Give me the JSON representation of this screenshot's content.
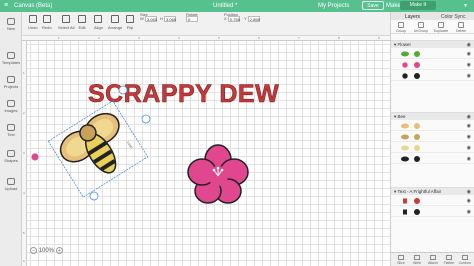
{
  "header": {
    "app_title": "Canvas (Beta)",
    "doc_title": "Untitled *",
    "my_projects": "My Projects",
    "save_label": "Save",
    "machine": "Maker",
    "make_it": "Make It"
  },
  "toolbar": {
    "undo": "Undo",
    "redo": "Redo",
    "linetype_label": "Linetype",
    "linetype_value": "Cut",
    "fill_label": "Fill",
    "fill_value": "No Fill",
    "select_all": "Select All",
    "edit": "Edit",
    "align": "Align",
    "arrange": "Arrange",
    "flip": "Flip",
    "size_label": "Size",
    "w_label": "W",
    "w_value": "3.065",
    "h_label": "H",
    "h_value": "3.065",
    "rotate_label": "Rotate",
    "rotate_value": "0",
    "position_label": "Position",
    "x_label": "X",
    "x_value": "0.758",
    "y_label": "Y",
    "y_value": "2.898"
  },
  "leftnav": {
    "items": [
      {
        "label": "New",
        "icon": "new-icon"
      },
      {
        "label": "Templates",
        "icon": "templates-icon"
      },
      {
        "label": "Projects",
        "icon": "projects-icon"
      },
      {
        "label": "Images",
        "icon": "images-icon"
      },
      {
        "label": "Text",
        "icon": "text-icon"
      },
      {
        "label": "Shapes",
        "icon": "shapes-icon"
      },
      {
        "label": "Upload",
        "icon": "upload-icon"
      }
    ]
  },
  "canvas": {
    "title_text": "SCRAPPY DEW",
    "zoom": "100%",
    "ruler_top": [
      "1",
      "2",
      "3",
      "4",
      "5",
      "6",
      "7",
      "8",
      "9"
    ],
    "ruler_left": [
      "1",
      "2",
      "3",
      "4",
      "5",
      "6"
    ],
    "selection_dims": "3.065\""
  },
  "panel": {
    "tab_layers": "Layers",
    "tab_colorsync": "Color Sync",
    "actions": [
      "Group",
      "UnGroup",
      "Duplicate",
      "Delete"
    ],
    "groups": [
      {
        "name": "Flower",
        "layers": [
          {
            "color": "#55a83a"
          },
          {
            "color": "#e0478f"
          },
          {
            "color": "#222222"
          }
        ]
      },
      {
        "name": "Bee",
        "layers": [
          {
            "color": "#e6c07a"
          },
          {
            "color": "#c9a25a"
          },
          {
            "color": "#e8d88c"
          },
          {
            "color": "#222222"
          }
        ]
      },
      {
        "name": "Text - A Frightful Affair",
        "layers": [
          {
            "color": "#c93c3c"
          },
          {
            "color": "#222222"
          }
        ]
      }
    ],
    "bottom": [
      "Slice",
      "Weld",
      "Attach",
      "Flatten",
      "Contour"
    ]
  },
  "colors": {
    "brand_green": "#57c08f",
    "title_red": "#c23a3a",
    "flower_pink": "#e0478f",
    "bee_yellow": "#e8d05a"
  }
}
